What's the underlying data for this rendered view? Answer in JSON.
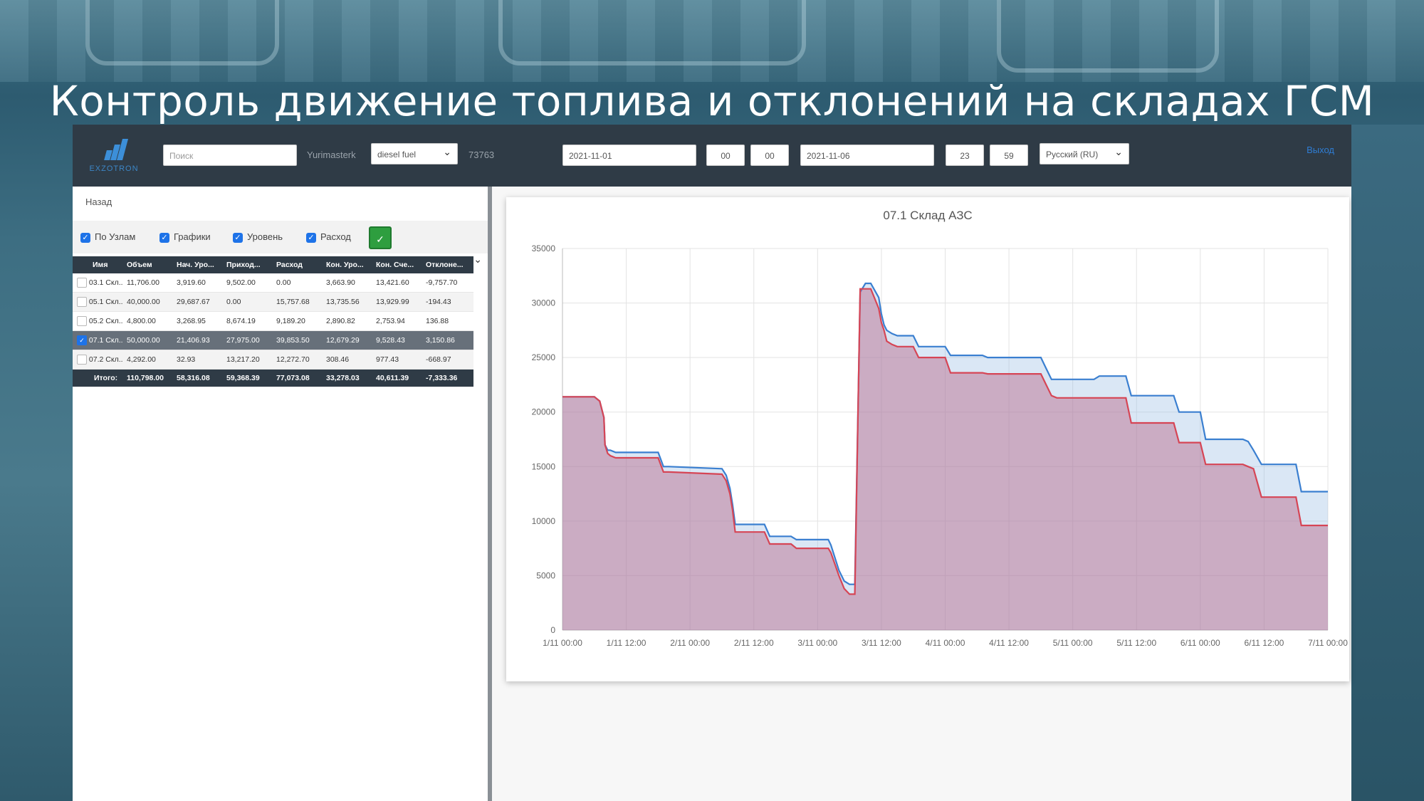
{
  "slide_title": "Контроль движение топлива и отклонений на складах ГСМ",
  "header": {
    "logo_text": "EXZOTRON",
    "search_placeholder": "Поиск",
    "user": "Yurimasterk",
    "fuel_select": "diesel fuel",
    "id_code": "73763",
    "date_from": "2021-11-01",
    "hour_from": "00",
    "min_from": "00",
    "date_to": "2021-11-06",
    "hour_to": "23",
    "min_to": "59",
    "language": "Русский (RU)",
    "logout": "Выход"
  },
  "left": {
    "back": "Назад",
    "filters": [
      {
        "label": "По Узлам",
        "checked": true
      },
      {
        "label": "Графики",
        "checked": true
      },
      {
        "label": "Уровень",
        "checked": true
      },
      {
        "label": "Расход",
        "checked": true
      }
    ],
    "apply_icon": "check-icon",
    "columns": [
      "Имя",
      "Объем",
      "Нач. Уро...",
      "Приход...",
      "Расход",
      "Кон. Уро...",
      "Кон. Сче...",
      "Отклоне..."
    ],
    "rows": [
      {
        "checked": false,
        "cells": [
          "03.1 Скл...",
          "11,706.00",
          "3,919.60",
          "9,502.00",
          "0.00",
          "3,663.90",
          "13,421.60",
          "-9,757.70"
        ]
      },
      {
        "checked": false,
        "cells": [
          "05.1 Скл...",
          "40,000.00",
          "29,687.67",
          "0.00",
          "15,757.68",
          "13,735.56",
          "13,929.99",
          "-194.43"
        ]
      },
      {
        "checked": false,
        "cells": [
          "05.2 Скл...",
          "4,800.00",
          "3,268.95",
          "8,674.19",
          "9,189.20",
          "2,890.82",
          "2,753.94",
          "136.88"
        ]
      },
      {
        "checked": true,
        "cells": [
          "07.1 Скл...",
          "50,000.00",
          "21,406.93",
          "27,975.00",
          "39,853.50",
          "12,679.29",
          "9,528.43",
          "3,150.86"
        ]
      },
      {
        "checked": false,
        "cells": [
          "07.2 Скл...",
          "4,292.00",
          "32.93",
          "13,217.20",
          "12,272.70",
          "308.46",
          "977.43",
          "-668.97"
        ]
      }
    ],
    "total": [
      "Итого:",
      "110,798.00",
      "58,316.08",
      "59,368.39",
      "77,073.08",
      "33,278.03",
      "40,611.39",
      "-7,333.36"
    ]
  },
  "chart_data": {
    "type": "area",
    "title": "07.1 Склад АЗС",
    "x_tick_labels": [
      "1/11 00:00",
      "1/11 12:00",
      "2/11 00:00",
      "2/11 12:00",
      "3/11 00:00",
      "3/11 12:00",
      "4/11 00:00",
      "4/11 12:00",
      "5/11 00:00",
      "5/11 12:00",
      "6/11 00:00",
      "6/11 12:00",
      "7/11 00:00"
    ],
    "xlim_hours": [
      0,
      144
    ],
    "y_tick_labels": [
      "0",
      "5000",
      "10000",
      "15000",
      "20000",
      "25000",
      "30000",
      "35000"
    ],
    "ylim": [
      0,
      35000
    ],
    "grid": true,
    "series": [
      {
        "color": "#3a7fd0",
        "fill": "rgba(150,185,225,0.35)",
        "x": [
          0,
          6,
          7,
          7.8,
          8,
          8.5,
          9,
          10,
          18,
          19,
          20,
          30,
          30.8,
          31.5,
          32,
          32.5,
          38,
          39,
          43,
          44,
          50,
          50.5,
          52,
          53,
          54,
          55,
          56,
          57,
          58,
          59.5,
          60,
          60.5,
          61,
          62,
          63,
          64,
          66,
          67,
          72,
          73,
          79,
          80,
          90,
          91,
          92,
          93,
          100,
          101,
          106,
          107,
          115,
          116,
          120,
          121,
          128,
          129,
          130,
          131.5,
          138,
          139,
          144
        ],
        "y": [
          21400,
          21400,
          21000,
          19500,
          17000,
          16500,
          16500,
          16300,
          16300,
          15000,
          15000,
          14800,
          14200,
          13000,
          11500,
          9700,
          9700,
          8600,
          8600,
          8300,
          8300,
          7800,
          5500,
          4500,
          4200,
          4200,
          31000,
          31800,
          31800,
          30500,
          29000,
          28000,
          27500,
          27200,
          27000,
          27000,
          27000,
          26000,
          26000,
          25200,
          25200,
          25000,
          25000,
          24000,
          23000,
          23000,
          23000,
          23300,
          23300,
          21500,
          21500,
          20000,
          20000,
          17500,
          17500,
          17300,
          16500,
          15200,
          15200,
          12700,
          12700
        ]
      },
      {
        "color": "#d64555",
        "fill": "rgba(185,100,135,0.45)",
        "x": [
          0,
          6,
          7,
          7.8,
          8,
          8.5,
          9,
          10,
          18,
          19,
          20,
          30,
          30.8,
          31.5,
          32,
          32.5,
          38,
          39,
          43,
          44,
          50,
          50.5,
          52,
          53,
          54,
          55,
          56,
          57,
          58,
          59.5,
          60,
          60.5,
          61,
          62,
          63,
          64,
          66,
          67,
          72,
          73,
          79,
          80,
          90,
          91,
          92,
          93,
          100,
          101,
          106,
          107,
          115,
          116,
          120,
          121,
          128,
          129,
          130,
          131.5,
          138,
          139,
          144
        ],
        "y": [
          21400,
          21400,
          21000,
          19500,
          17000,
          16200,
          16000,
          15800,
          15800,
          14500,
          14500,
          14300,
          13700,
          12500,
          11000,
          9000,
          9000,
          7900,
          7900,
          7500,
          7500,
          7100,
          5000,
          3800,
          3300,
          3300,
          31300,
          31300,
          31300,
          29500,
          28200,
          27500,
          26500,
          26200,
          26000,
          26000,
          26000,
          25000,
          25000,
          23600,
          23600,
          23500,
          23500,
          22500,
          21500,
          21300,
          21300,
          21300,
          21300,
          19000,
          19000,
          17200,
          17200,
          15200,
          15200,
          15000,
          14800,
          12200,
          12200,
          9600,
          9600
        ]
      }
    ]
  }
}
